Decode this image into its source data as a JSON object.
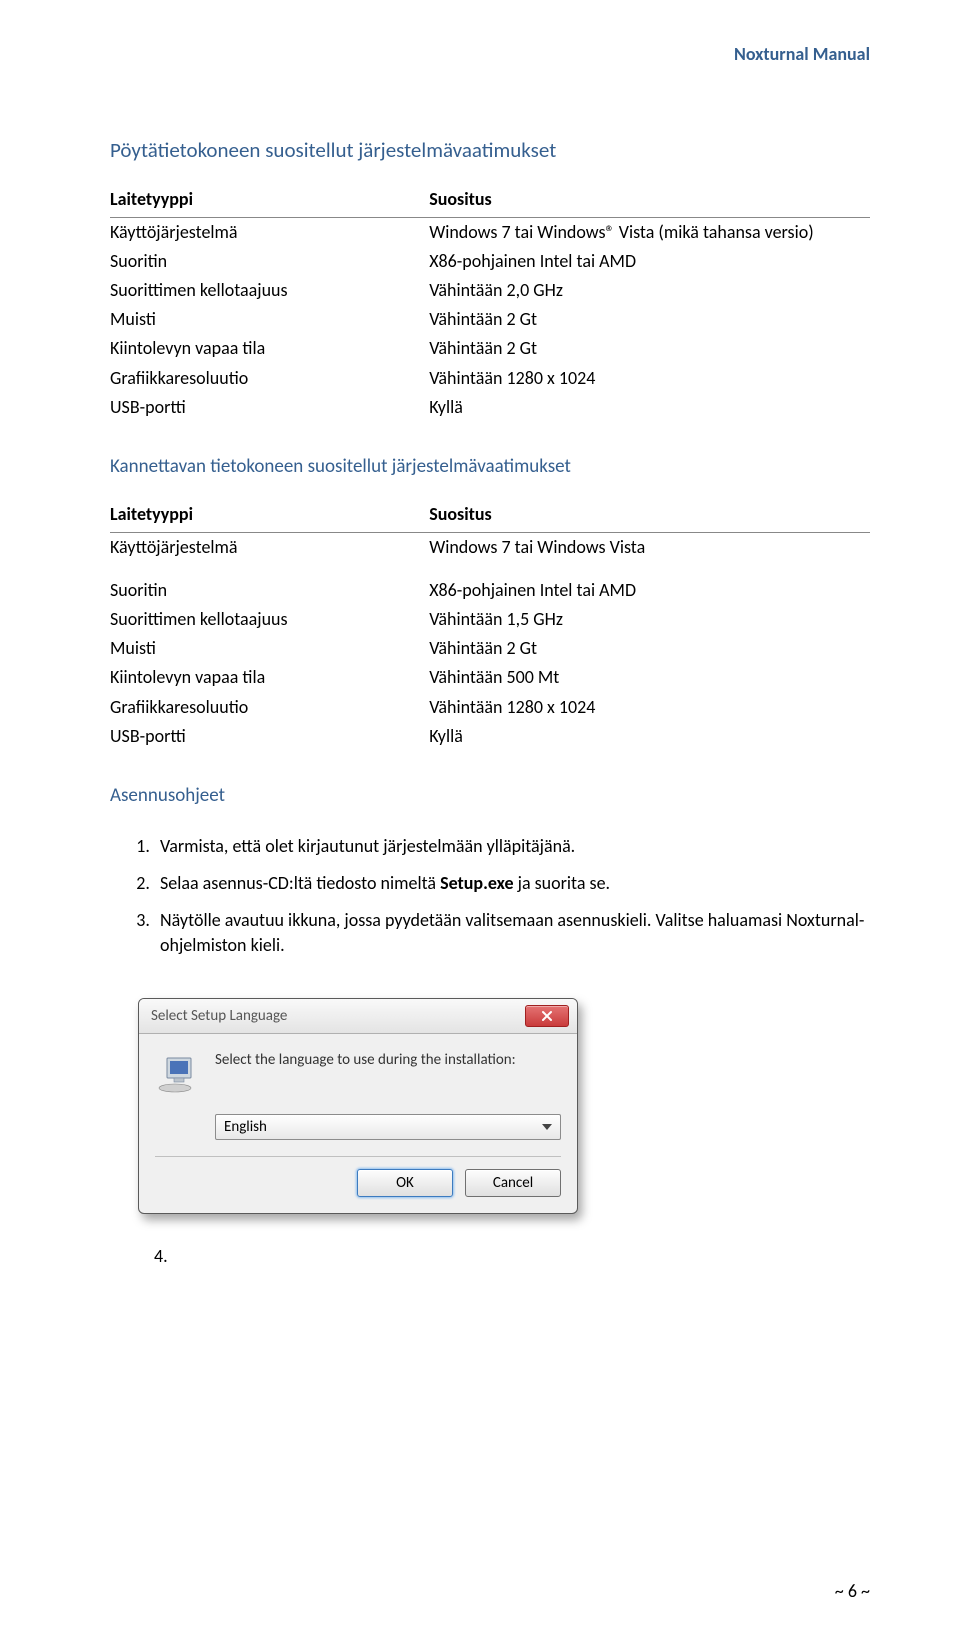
{
  "header": {
    "manual_title": "Noxturnal Manual"
  },
  "section1": {
    "heading": "Pöytätietokoneen suositellut järjestelmävaatimukset",
    "col1": "Laitetyyppi",
    "col2": "Suositus",
    "rows": [
      {
        "a": "Käyttöjärjestelmä",
        "b": "Windows 7 tai Windows® Vista (mikä tahansa versio)"
      },
      {
        "a": "Suoritin",
        "b": "X86-pohjainen Intel tai AMD"
      },
      {
        "a": "Suorittimen kellotaajuus",
        "b": "Vähintään 2,0 GHz"
      },
      {
        "a": "Muisti",
        "b": "Vähintään 2 Gt"
      },
      {
        "a": "Kiintolevyn vapaa tila",
        "b": "Vähintään 2 Gt"
      },
      {
        "a": "Grafiikkaresoluutio",
        "b": "Vähintään 1280 x 1024"
      },
      {
        "a": "USB-portti",
        "b": "Kyllä"
      }
    ]
  },
  "section2": {
    "heading": "Kannettavan tietokoneen suositellut järjestelmävaatimukset",
    "col1": "Laitetyyppi",
    "col2": "Suositus",
    "rows": [
      {
        "a": "Käyttöjärjestelmä",
        "b": "Windows 7 tai Windows Vista"
      },
      {
        "a": "Suoritin",
        "b": "X86-pohjainen Intel tai AMD"
      },
      {
        "a": "Suorittimen kellotaajuus",
        "b": "Vähintään 1,5 GHz"
      },
      {
        "a": "Muisti",
        "b": "Vähintään 2 Gt"
      },
      {
        "a": "Kiintolevyn vapaa tila",
        "b": "Vähintään 500 Mt"
      },
      {
        "a": "Grafiikkaresoluutio",
        "b": "Vähintään 1280 x 1024"
      },
      {
        "a": "USB-portti",
        "b": "Kyllä"
      }
    ]
  },
  "install": {
    "heading": "Asennusohjeet",
    "steps": [
      "Varmista, että olet kirjautunut järjestelmään ylläpitäjänä.",
      "Selaa asennus-CD:ltä tiedosto nimeltä Setup.exe ja suorita se.",
      "Näytölle avautuu ikkuna, jossa pyydetään valitsemaan asennuskieli. Valitse haluamasi Noxturnal-ohjelmiston kieli."
    ],
    "trailing_num": "4."
  },
  "dialog": {
    "title": "Select Setup Language",
    "text": "Select the language to use during the installation:",
    "selected": "English",
    "ok": "OK",
    "cancel": "Cancel"
  },
  "footer": {
    "page": "~ 6 ~"
  }
}
